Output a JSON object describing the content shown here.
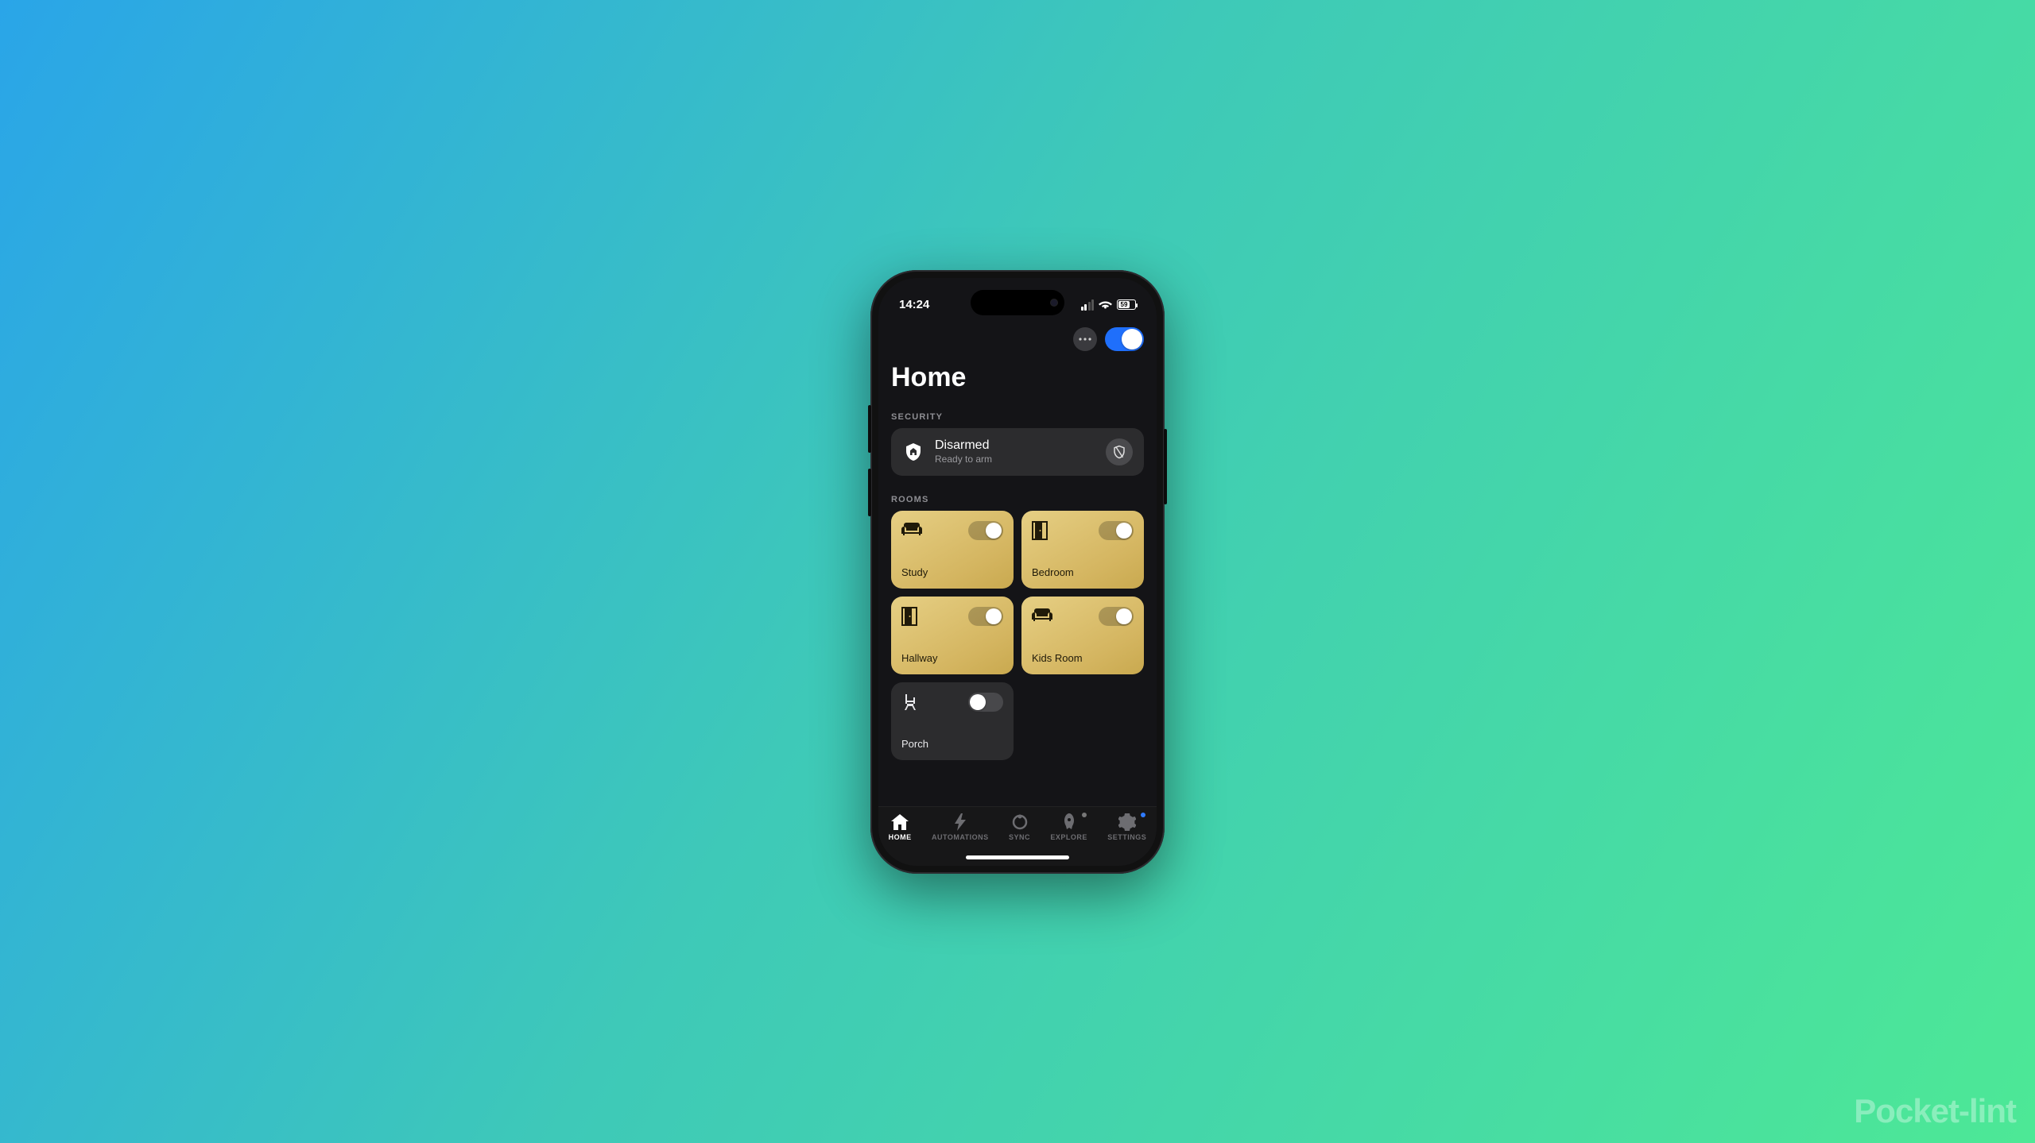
{
  "watermark": "Pocket-lint",
  "status": {
    "time": "14:24",
    "battery": "59"
  },
  "header": {
    "title": "Home",
    "more_button_name": "more-options",
    "main_toggle_on": true
  },
  "security": {
    "section_label": "SECURITY",
    "title": "Disarmed",
    "subtitle": "Ready to arm"
  },
  "rooms_section_label": "ROOMS",
  "rooms": [
    {
      "name": "Study",
      "icon": "sofa",
      "on": true
    },
    {
      "name": "Bedroom",
      "icon": "door",
      "on": true
    },
    {
      "name": "Hallway",
      "icon": "door",
      "on": true
    },
    {
      "name": "Kids Room",
      "icon": "sofa",
      "on": true
    },
    {
      "name": "Porch",
      "icon": "chair",
      "on": false
    }
  ],
  "tabs": [
    {
      "label": "HOME",
      "icon": "home",
      "active": true
    },
    {
      "label": "AUTOMATIONS",
      "icon": "bolt",
      "active": false,
      "dot": null
    },
    {
      "label": "SYNC",
      "icon": "sync",
      "active": false
    },
    {
      "label": "EXPLORE",
      "icon": "rocket",
      "active": false,
      "dot": "#777"
    },
    {
      "label": "SETTINGS",
      "icon": "gear",
      "active": false,
      "dot": "#2f7bff"
    }
  ]
}
